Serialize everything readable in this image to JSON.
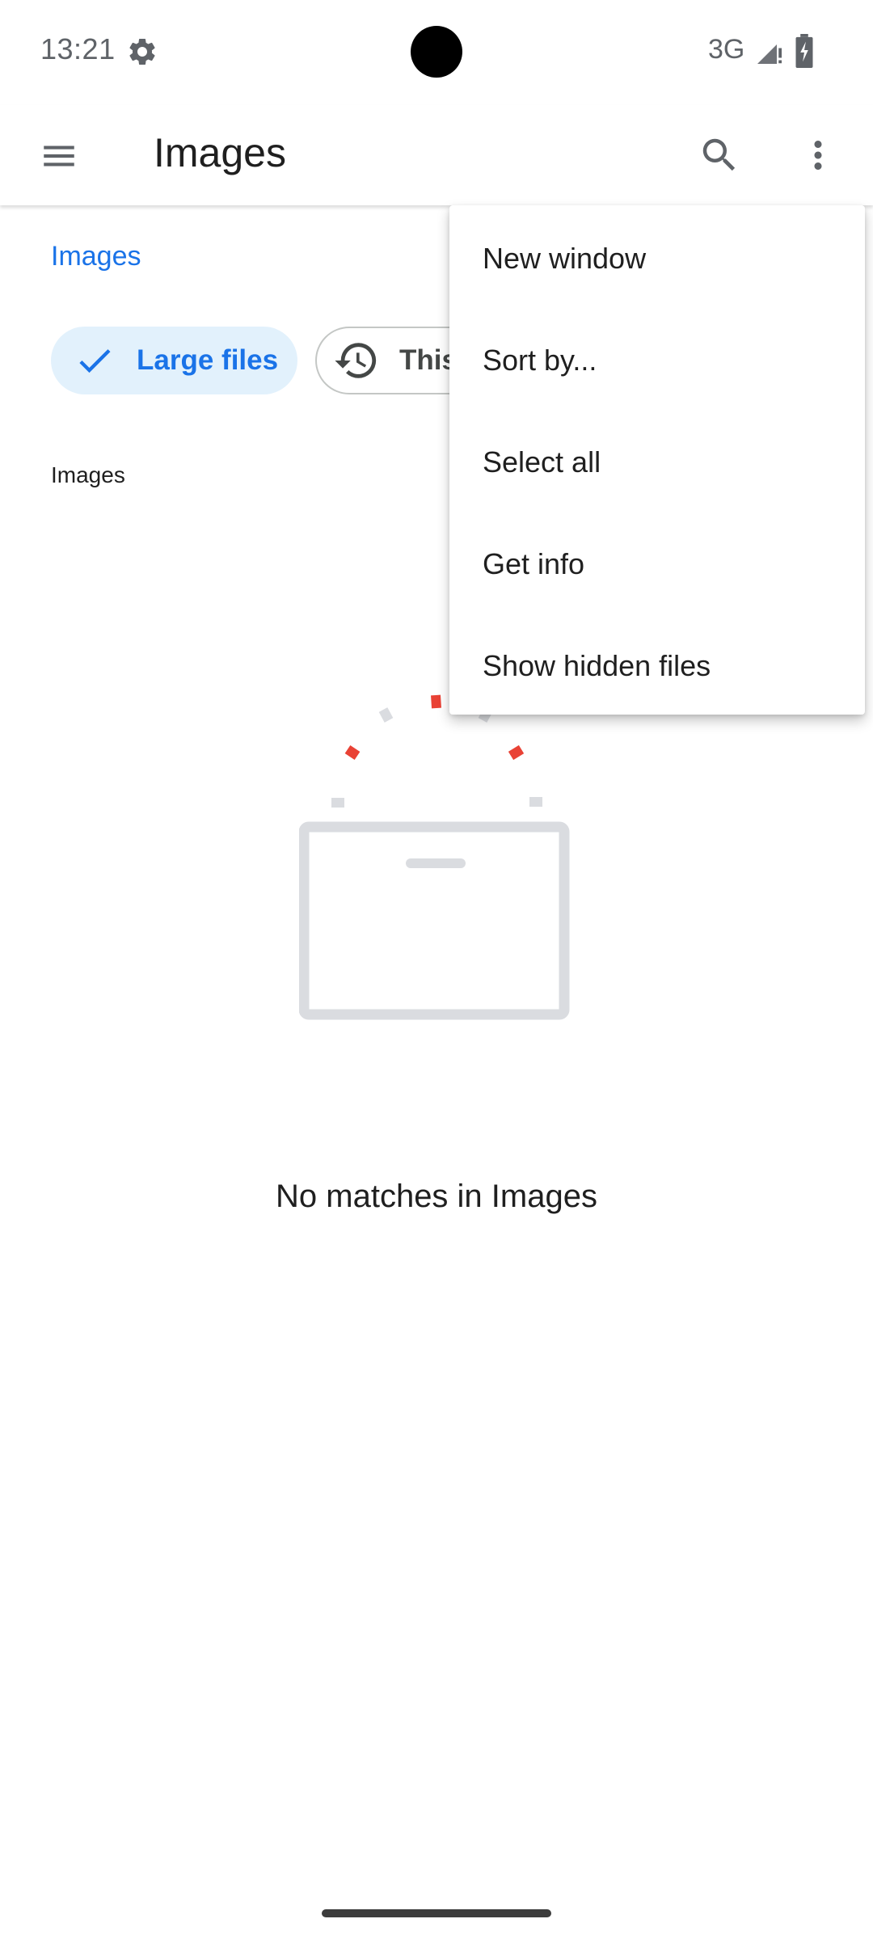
{
  "status_bar": {
    "time": "13:21",
    "network": "3G",
    "icons": [
      "gear-icon",
      "signal-icon",
      "battery-icon"
    ]
  },
  "app_bar": {
    "title": "Images",
    "icons": [
      "menu-icon",
      "search-icon",
      "more-vert-icon"
    ]
  },
  "breadcrumb": {
    "label": "Images"
  },
  "filters": {
    "chips": [
      {
        "label": "Large files",
        "selected": true,
        "icon": "check-icon"
      },
      {
        "label": "This week",
        "selected": false,
        "icon": "history-icon"
      }
    ]
  },
  "section": {
    "title": "Images"
  },
  "empty_state": {
    "message": "No matches in Images",
    "illustration": "empty-box-illustration"
  },
  "overflow_menu": {
    "items": [
      {
        "label": "New window"
      },
      {
        "label": "Sort by..."
      },
      {
        "label": "Select all"
      },
      {
        "label": "Get info"
      },
      {
        "label": "Show hidden files"
      }
    ]
  },
  "colors": {
    "accent": "#1a73e8",
    "chip_selected_bg": "#e2f1fc",
    "illustration_red": "#e94235",
    "illustration_gray": "#dadce0"
  }
}
